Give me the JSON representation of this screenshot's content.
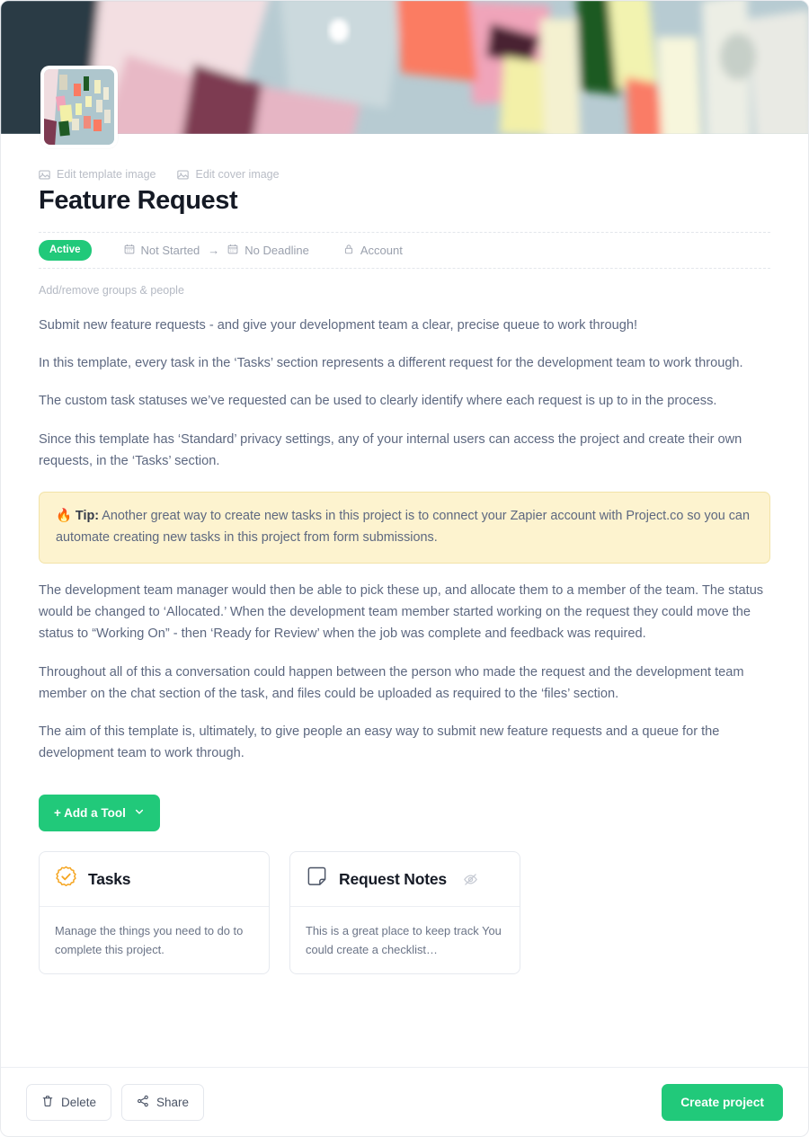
{
  "header": {
    "edit_template_image": "Edit template image",
    "edit_cover_image": "Edit cover image",
    "title": "Feature Request",
    "status_badge": "Active",
    "start_date": "Not Started",
    "arrow": "→",
    "deadline": "No Deadline",
    "privacy": "Account",
    "groups_link": "Add/remove groups & people"
  },
  "body": {
    "paragraphs": [
      "Submit new feature requests - and give your development team a clear, precise queue to work through!",
      "In this template, every task in the ‘Tasks’ section represents a different request for the development team to work through.",
      "The custom task statuses we’ve requested can be used to clearly identify where each request is up to in the process.",
      "Since this template has ‘Standard’ privacy settings, any of your internal users can access the project and create their own requests, in the ‘Tasks’ section."
    ],
    "tip": {
      "emoji": "🔥",
      "label": "Tip:",
      "text": " Another great way to create new tasks in this project is to connect your Zapier account with Project.co so you can automate creating new tasks in this project from form submissions."
    },
    "paragraphs_after": [
      "The development team manager would then be able to pick these up, and allocate them to a member of the team. The status would be changed to ‘Allocated.’ When the development team member started working on the request they could move the status to “Working On” - then ‘Ready for Review’ when the job was complete and feedback was required.",
      "Throughout all of this a conversation could happen between the person who made the request and the development team member on the chat section of the task, and files could be uploaded as required to the ‘files’ section.",
      "The aim of this template is, ultimately, to give people an easy way to submit new feature requests and a queue for the development team to work through."
    ]
  },
  "tools": {
    "add_tool_label": "+ Add a Tool",
    "cards": [
      {
        "icon": "tasks-badge-check-icon",
        "title": "Tasks",
        "description": "Manage the things you need to do to complete this project.",
        "hidden": false
      },
      {
        "icon": "note-icon",
        "title": "Request Notes",
        "description": "This is a great place to keep track You could create a checklist…",
        "hidden": true
      }
    ]
  },
  "footer": {
    "delete_label": "Delete",
    "share_label": "Share",
    "create_label": "Create project"
  },
  "colors": {
    "accent_green": "#21c97a",
    "tip_background": "#fdf3cf",
    "tip_border": "#f2e3a8",
    "task_icon_orange": "#f5a623",
    "text_body": "#5d6880",
    "text_heading": "#151a25"
  }
}
